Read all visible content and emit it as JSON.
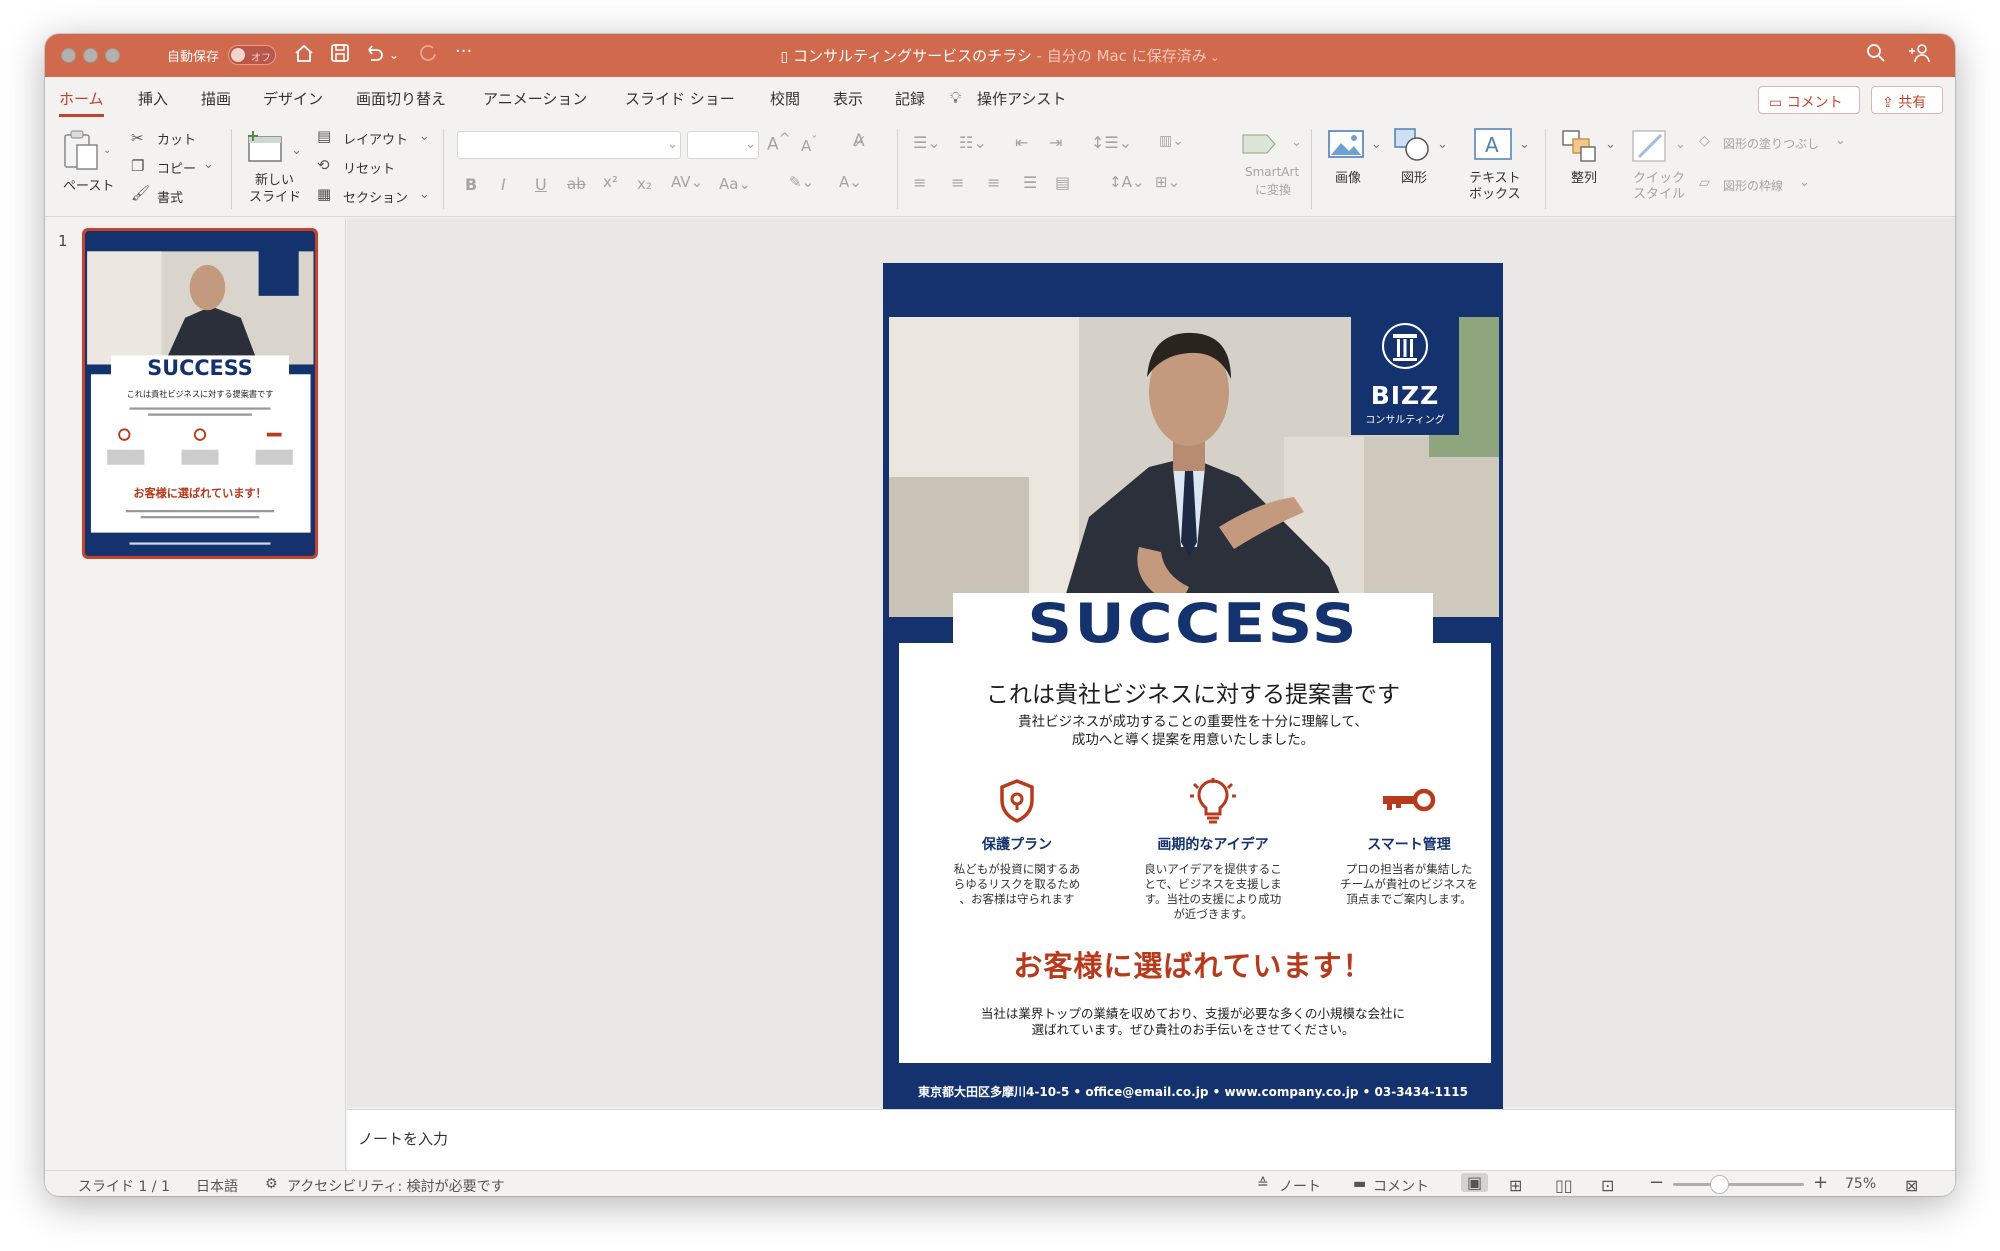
{
  "titlebar": {
    "autosave_label": "自動保存",
    "autosave_state": "オフ",
    "doc_title": "コンサルティングサービスのチラシ",
    "doc_location": " - 自分の Mac に保存済み"
  },
  "tabs": [
    {
      "label": "ホーム",
      "active": true
    },
    {
      "label": "挿入"
    },
    {
      "label": "描画"
    },
    {
      "label": "デザイン"
    },
    {
      "label": "画面切り替え"
    },
    {
      "label": "アニメーション"
    },
    {
      "label": "スライド ショー"
    },
    {
      "label": "校閲"
    },
    {
      "label": "表示"
    },
    {
      "label": "記録"
    },
    {
      "label": "操作アシスト"
    }
  ],
  "header_actions": {
    "comment": "コメント",
    "share": "共有"
  },
  "ribbon": {
    "paste": "ペースト",
    "cut": "カット",
    "copy": "コピー",
    "format": "書式",
    "new_slide_1": "新しい",
    "new_slide_2": "スライド",
    "layout": "レイアウト",
    "reset": "リセット",
    "section": "セクション",
    "smartart_1": "SmartArt",
    "smartart_2": "に変換",
    "image": "画像",
    "shape": "図形",
    "textbox_1": "テキスト",
    "textbox_2": "ボックス",
    "arrange": "整列",
    "quick_style_1": "クイック",
    "quick_style_2": "スタイル",
    "shape_fill": "図形の塗りつぶし",
    "shape_outline": "図形の枠線"
  },
  "thumbnail": {
    "number": "1"
  },
  "slide": {
    "logo_name": "BIZZ",
    "logo_sub": "コンサルティング",
    "headline": "SUCCESS",
    "subhead": "これは貴社ビジネスに対する提案書です",
    "lead_1": "貴社ビジネスが成功することの重要性を十分に理解して、",
    "lead_2": "成功へと導く提案を用意いたしました。",
    "features": [
      {
        "icon": "shield-icon",
        "title": "保護プラン",
        "lines": [
          "私どもが投資に関するあ",
          "らゆるリスクを取るため",
          "、お客様は守られます"
        ]
      },
      {
        "icon": "lightbulb-icon",
        "title": "画期的なアイデア",
        "lines": [
          "良いアイデアを提供するこ",
          "とで、ビジネスを支援しま",
          "す。当社の支援により成功",
          "が近づきます。"
        ]
      },
      {
        "icon": "key-icon",
        "title": "スマート管理",
        "lines": [
          "プロの担当者が集結した",
          "チームが貴社のビジネスを",
          "頂点までご案内します。"
        ]
      }
    ],
    "cta": "お客様に選ばれています！",
    "desc_1": "当社は業界トップの業績を収めており、支援が必要な多くの小規模な会社に",
    "desc_2": "選ばれています。ぜひ貴社のお手伝いをさせてください。",
    "footer": "東京都大田区多摩川4-10-5 • office@email.co.jp • www.company.co.jp • 03-3434-1115"
  },
  "notes_placeholder": "ノートを入力",
  "statusbar": {
    "slide_pos": "スライド 1 / 1",
    "language": "日本語",
    "accessibility": "アクセシビリティ: 検討が必要です",
    "notes": "ノート",
    "comments": "コメント",
    "zoom": "75%"
  },
  "colors": {
    "accent": "#d16a4d",
    "navy": "#14326e",
    "red": "#b83a1c"
  }
}
